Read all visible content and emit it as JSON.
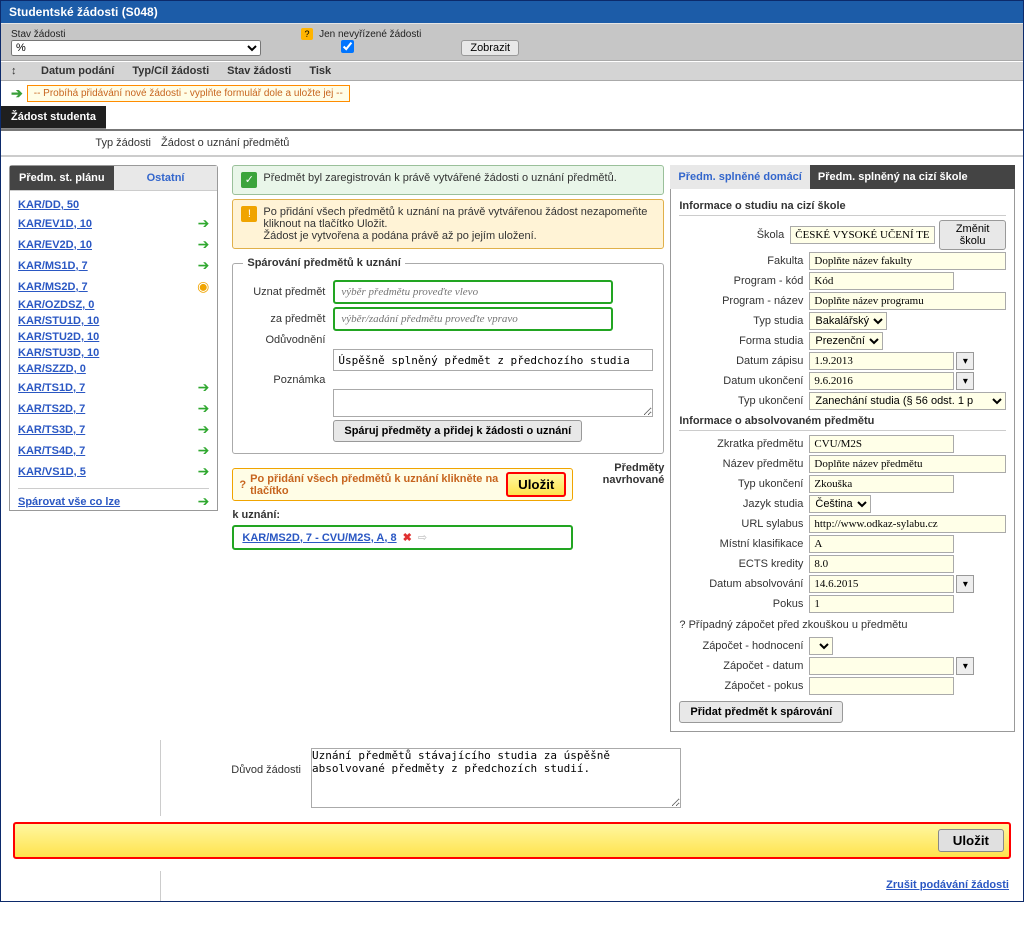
{
  "title": "Studentské žádosti (S048)",
  "filter": {
    "stav_label": "Stav žádosti",
    "stav_value": "%",
    "jen_label": "Jen nevyřízené žádosti",
    "zobrazit": "Zobrazit"
  },
  "grid": {
    "col1": "Datum podání",
    "col2": "Typ/Cíl žádosti",
    "col3": "Stav žádosti",
    "col4": "Tisk",
    "newmsg": "-- Probíhá přidávání nové žádosti - vyplňte formulář dole a uložte jej --"
  },
  "zs_tab": "Žádost studenta",
  "typ_label": "Typ žádosti",
  "typ_value": "Žádost o uznání předmětů",
  "left": {
    "tab1": "Předm. st. plánu",
    "tab2": "Ostatní",
    "items": [
      {
        "t": "KAR/DD, 50",
        "i": ""
      },
      {
        "t": "KAR/EV1D, 10",
        "i": "ar"
      },
      {
        "t": "KAR/EV2D, 10",
        "i": "ar"
      },
      {
        "t": "KAR/MS1D, 7",
        "i": "ar"
      },
      {
        "t": "KAR/MS2D, 7",
        "i": "warn"
      },
      {
        "t": "KAR/OZDSZ, 0",
        "i": ""
      },
      {
        "t": "KAR/STU1D, 10",
        "i": ""
      },
      {
        "t": "KAR/STU2D, 10",
        "i": ""
      },
      {
        "t": "KAR/STU3D, 10",
        "i": ""
      },
      {
        "t": "KAR/SZZD, 0",
        "i": ""
      },
      {
        "t": "KAR/TS1D, 7",
        "i": "ar"
      },
      {
        "t": "KAR/TS2D, 7",
        "i": "ar"
      },
      {
        "t": "KAR/TS3D, 7",
        "i": "ar"
      },
      {
        "t": "KAR/TS4D, 7",
        "i": "ar"
      },
      {
        "t": "KAR/VS1D, 5",
        "i": "ar"
      }
    ],
    "footer": "Spárovat vše co lze"
  },
  "mid": {
    "info": "Předmět byl zaregistrován k právě vytvářené žádosti o uznání předmětů.",
    "warn1": "Po přidání všech předmětů k uznání na právě vytvářenou žádost nezapomeňte kliknout na tlačítko Uložit.",
    "warn2": "Žádost je vytvořena a podána právě až po jejím uložení.",
    "fs_legend": "Spárování předmětů k uznání",
    "uznat_label": "Uznat předmět",
    "uznat_ph": "výběr předmětu proveďte vlevo",
    "za_label": "za předmět",
    "za_ph": "výběr/zadání předmětu proveďte vpravo",
    "oduv_label": "Odůvodnění",
    "oduv_val": "Úspěšně splněný předmět z předchozího studia",
    "pozn_label": "Poznámka",
    "sparuj_btn": "Spáruj předměty a přidej k žádosti o uznání",
    "save_lbl": "Po přidání všech předmětů k uznání klikněte na tlačítko",
    "ulozit": "Uložit",
    "prop_lbl1": "Předměty navrhované",
    "prop_lbl2": "k uznání:",
    "prop_item": "KAR/MS2D, 7 - CVU/M2S, A, 8"
  },
  "right": {
    "tab1": "Předm. splněné domácí",
    "tab2": "Předm. splněný na cizí škole",
    "sect1": "Informace o studiu na cizí škole",
    "skola_l": "Škola",
    "skola_v": "ČESKÉ VYSOKÉ UČENÍ TEC",
    "zmenit": "Změnit školu",
    "fak_l": "Fakulta",
    "fak_v": "Doplňte název fakulty",
    "pkod_l": "Program - kód",
    "pkod_v": "Kód",
    "pnaz_l": "Program - název",
    "pnaz_v": "Doplňte název programu",
    "tstud_l": "Typ studia",
    "tstud_v": "Bakalářský",
    "forma_l": "Forma studia",
    "forma_v": "Prezenční",
    "zap_l": "Datum zápisu",
    "zap_v": "1.9.2013",
    "ukon_l": "Datum ukončení",
    "ukon_v": "9.6.2016",
    "typu_l": "Typ ukončení",
    "typu_v": "Zanechání studia (§ 56 odst. 1 p",
    "sect2": "Informace o absolvovaném předmětu",
    "zkr_l": "Zkratka předmětu",
    "zkr_v": "CVU/M2S",
    "npr_l": "Název předmětu",
    "npr_v": "Doplňte název předmětu",
    "typu2_l": "Typ ukončení",
    "typu2_v": "Zkouška",
    "jaz_l": "Jazyk studia",
    "jaz_v": "Čeština",
    "url_l": "URL sylabus",
    "url_v": "http://www.odkaz-sylabu.cz",
    "kl_l": "Místní klasifikace",
    "kl_v": "A",
    "ects_l": "ECTS kredity",
    "ects_v": "8.0",
    "abs_l": "Datum absolvování",
    "abs_v": "14.6.2015",
    "pok_l": "Pokus",
    "pok_v": "1",
    "zap_note": "Případný zápočet před zkouškou u předmětu",
    "zh_l": "Zápočet - hodnocení",
    "zd_l": "Zápočet - datum",
    "zp_l": "Zápočet - pokus",
    "addbtn": "Přidat předmět k spárování"
  },
  "bottom": {
    "duvod_l": "Důvod žádosti",
    "duvod_v": "Uznání předmětů stávajícího studia za úspěšně absolvované předměty z předchozích studií.",
    "ulozit": "Uložit",
    "cancel": "Zrušit podávání žádosti"
  }
}
